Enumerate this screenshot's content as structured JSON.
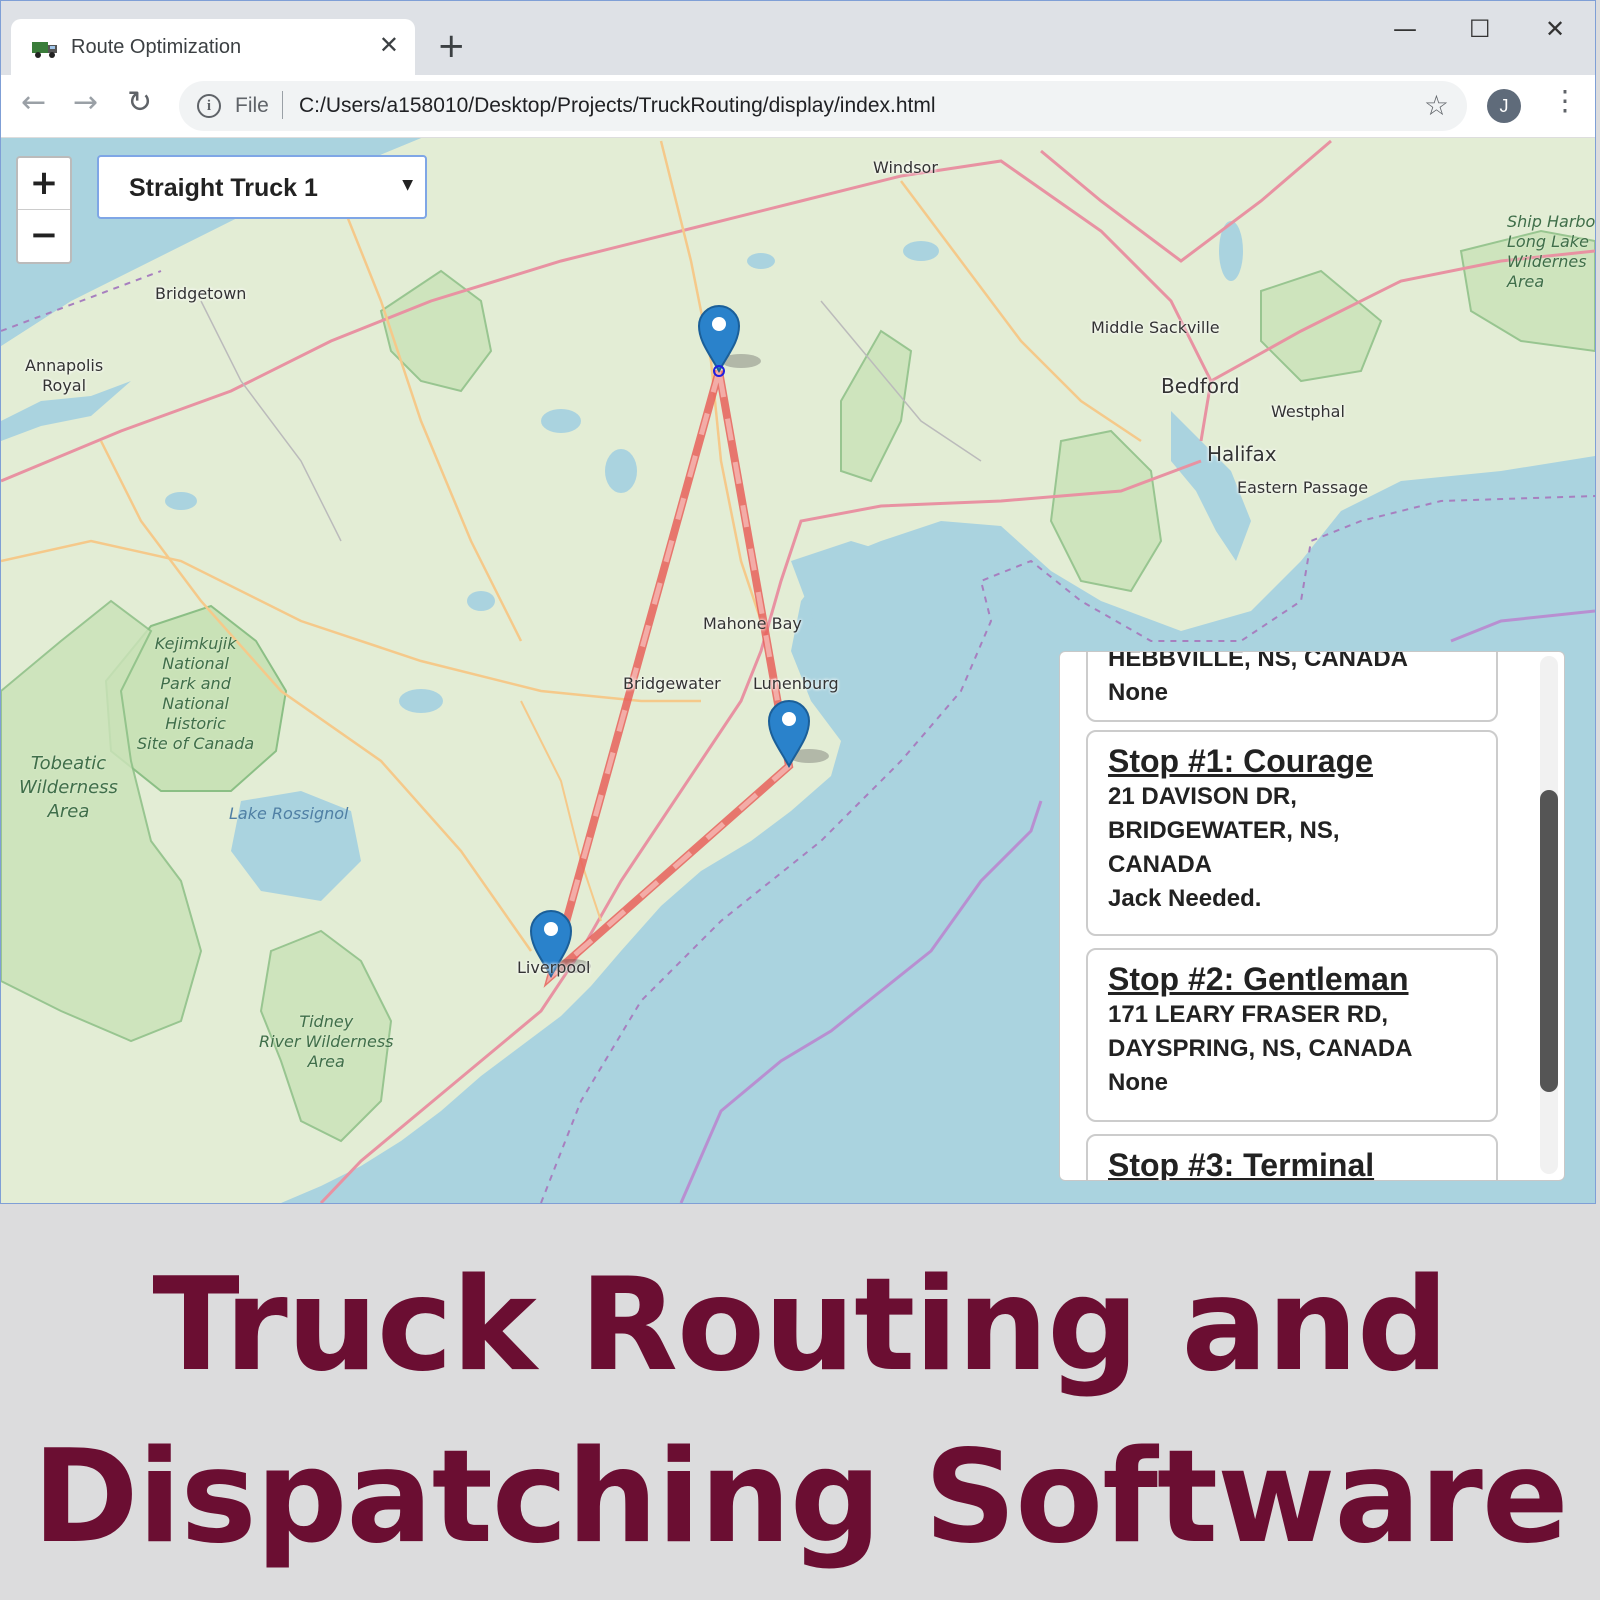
{
  "browser": {
    "tab_title": "Route Optimization",
    "tab_close": "✕",
    "new_tab": "+",
    "window_controls": {
      "minimize": "—",
      "maximize": "☐",
      "close": "✕"
    },
    "nav": {
      "back": "←",
      "forward": "→",
      "reload": "↻"
    },
    "url_scheme": "File",
    "url": "C:/Users/a158010/Desktop/Projects/TruckRouting/display/index.html",
    "profile_initial": "J",
    "icons": [
      "truck-icon",
      "info-icon",
      "star-icon",
      "menu-icon"
    ]
  },
  "map": {
    "zoom_in": "+",
    "zoom_out": "−",
    "truck_select": {
      "value": "Straight Truck 1",
      "arrow": "▼"
    },
    "places": {
      "windsor": "Windsor",
      "bridgetown": "Bridgetown",
      "annapolis": "Annapolis\nRoyal",
      "middle_sackville": "Middle Sackville",
      "bedford": "Bedford",
      "westphal": "Westphal",
      "halifax": "Halifax",
      "eastern_passage": "Eastern Passage",
      "mahone_bay": "Mahone Bay",
      "bridgewater": "Bridgewater",
      "lunenburg": "Lunenburg",
      "liverpool": "Liverpool"
    },
    "parks": {
      "kejimkujik": "Kejimkujik\nNational\nPark and\nNational\nHistoric\nSite of Canada",
      "tobeatic": "Tobeatic\nWilderness\nArea",
      "tidney": "Tidney\nRiver Wilderness\nArea",
      "ship_harbour": "Ship Harbo\nLong Lake\nWildernes\nArea"
    },
    "water": {
      "lake_rossignol": "Lake Rossignol"
    },
    "route_color": "#e8605a",
    "marker_color": "#2a82cb"
  },
  "stops": [
    {
      "lines": [
        "HEBBVILLE, NS, CANADA",
        "None"
      ]
    },
    {
      "title": "Stop #1: Courage",
      "lines": [
        "21 DAVISON DR,",
        "BRIDGEWATER, NS,",
        "CANADA",
        "Jack Needed."
      ]
    },
    {
      "title": "Stop #2: Gentleman",
      "lines": [
        "171 LEARY FRASER RD,",
        "DAYSPRING, NS, CANADA",
        "None"
      ]
    },
    {
      "title": "Stop #3: Terminal"
    }
  ],
  "headline": {
    "line1": "Truck Routing and",
    "line2": "Dispatching Software"
  }
}
